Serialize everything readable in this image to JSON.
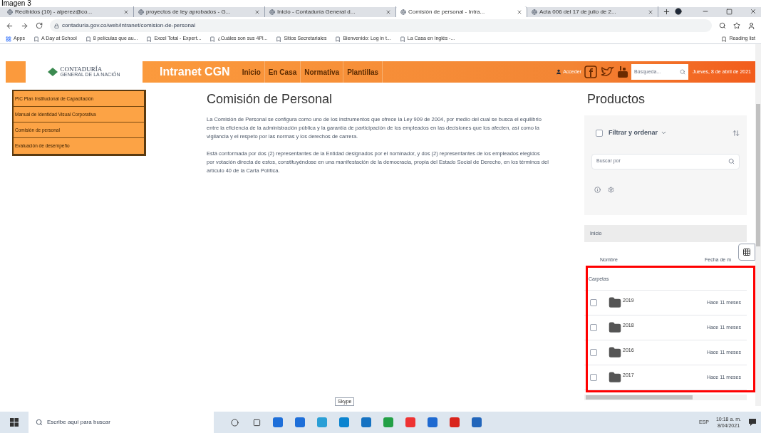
{
  "caption": "Imagen 3",
  "browser": {
    "tabs": [
      {
        "title": "Recibidos (10) - alperez@co...",
        "selected": false
      },
      {
        "title": "proyectos de ley aprobados - G...",
        "selected": false
      },
      {
        "title": "Inicio - Contaduría General d...",
        "selected": false
      },
      {
        "title": "Comisión de personal - Intra...",
        "selected": true
      },
      {
        "title": "Acta 006 del 17 de julio de 2...",
        "selected": false
      }
    ],
    "url": "contaduria.gov.co/web/intranet/comision-de-personal",
    "bookmarks": [
      "Apps",
      "A Day at School",
      "8 películas que au...",
      "Excel Total - Expert...",
      "¿Cuáles son sus 4Pl...",
      "Sitios Secretariales",
      "Bienvenido: Log in t...",
      "La Casa en Inglés -..."
    ],
    "reading_list": "Reading list"
  },
  "site": {
    "logo_name": "CONTADURÍA",
    "logo_sub": "GENERAL DE LA NACIÓN",
    "brand": "Intranet CGN",
    "nav": [
      "Inicio",
      "En Casa",
      "Normativa",
      "Plantillas"
    ],
    "login": "Acceder",
    "search_placeholder": "Búsqueda...",
    "date": "Jueves, 8 de abril de 2021"
  },
  "sidebar": {
    "items": [
      "PIC Plan Institucional de Capacitación",
      "Manual de Identidad Visual Corporativa",
      "Comisión de personal",
      "Evaluación de desempeño"
    ]
  },
  "article": {
    "title": "Comisión de Personal",
    "paragraphs": [
      "La Comisión de Personal se configura como uno de los instrumentos que ofrece la Ley 909 de 2004, por medio del cual se busca el equilibrio entre la eficiencia de la administración pública y la garantía de participación de los empleados en las decisiones que los afecten, así como la vigilancia y el respeto por las normas y los derechos de carrera.",
      "Está conformada por dos (2) representantes de la Entidad designados por el nominador, y dos (2) representantes de los empleados elegidos por votación directa de estos, constituyéndose en una manifestación de la democracia, propia del Estado Social de Derecho, en los términos del artículo 40 de la Carta Política."
    ]
  },
  "products": {
    "title": "Productos",
    "filter": "Filtrar y ordenar",
    "search_placeholder": "Buscar por",
    "breadcrumb": "Inicio",
    "select_all_checked": false,
    "columns": [
      "Nombre",
      "Fecha de m"
    ],
    "section": "Carpetas",
    "rows": [
      {
        "name": "2019",
        "modified": "Hace 11 meses",
        "checked": false
      },
      {
        "name": "2018",
        "modified": "Hace 11 meses",
        "checked": false
      },
      {
        "name": "2016",
        "modified": "Hace 11 meses",
        "checked": false
      },
      {
        "name": "2017",
        "modified": "Hace 11 meses",
        "checked": false
      }
    ]
  },
  "taskbar": {
    "search_placeholder": "Escribe aquí para buscar",
    "tooltip": "Skype",
    "language": "ESP",
    "time": "10:18 a. m.",
    "date": "8/04/2021"
  }
}
